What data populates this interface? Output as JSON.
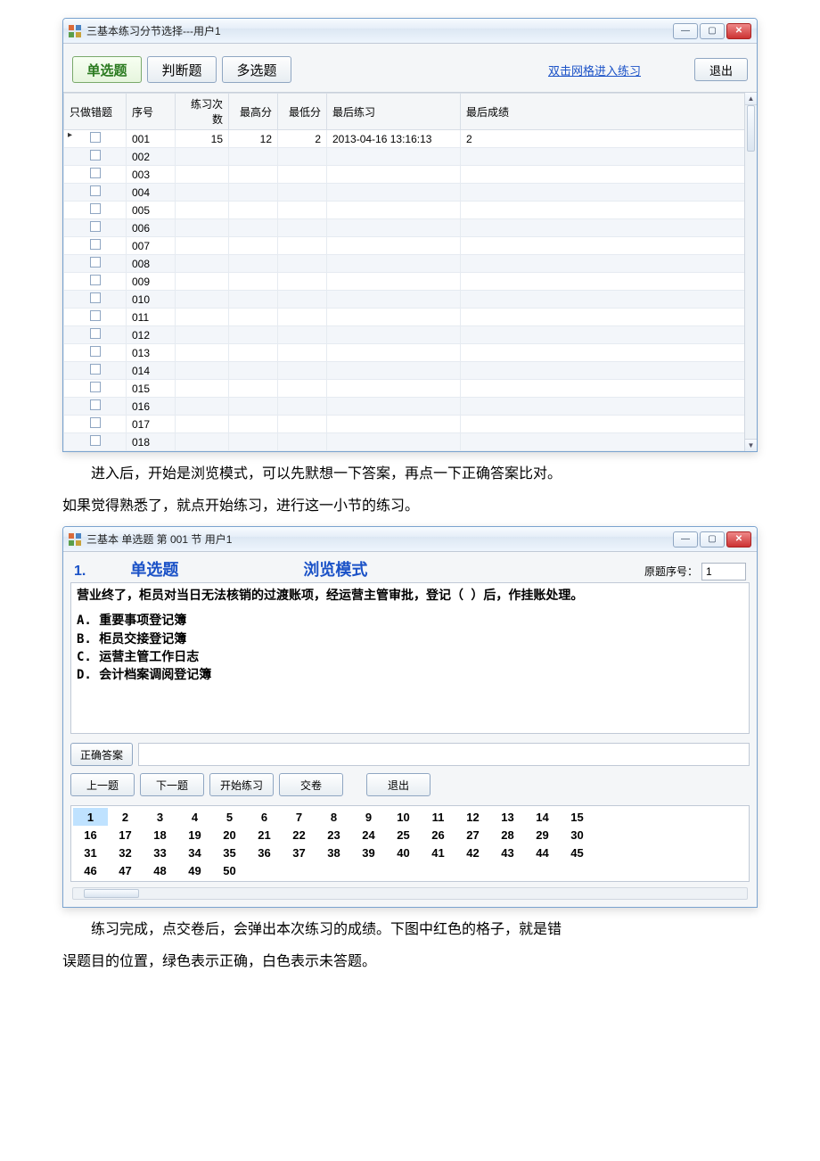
{
  "win1": {
    "title": "三基本练习分节选择---用户1",
    "tabs": {
      "single": "单选题",
      "judge": "判断题",
      "multi": "多选题"
    },
    "hint": "双击网格进入练习",
    "exit": "退出",
    "columns": {
      "only_wrong": "只做错题",
      "seq": "序号",
      "times": "练习次数",
      "high": "最高分",
      "low": "最低分",
      "last_time": "最后练习",
      "last_score": "最后成绩"
    },
    "rows": [
      {
        "seq": "001",
        "times": "15",
        "high": "12",
        "low": "2",
        "last_time": "2013-04-16 13:16:13",
        "last_score": "2"
      },
      {
        "seq": "002"
      },
      {
        "seq": "003"
      },
      {
        "seq": "004"
      },
      {
        "seq": "005"
      },
      {
        "seq": "006"
      },
      {
        "seq": "007"
      },
      {
        "seq": "008"
      },
      {
        "seq": "009"
      },
      {
        "seq": "010"
      },
      {
        "seq": "011"
      },
      {
        "seq": "012"
      },
      {
        "seq": "013"
      },
      {
        "seq": "014"
      },
      {
        "seq": "015"
      },
      {
        "seq": "016"
      },
      {
        "seq": "017"
      },
      {
        "seq": "018"
      }
    ]
  },
  "para1a": "进入后，开始是浏览模式，可以先默想一下答案，再点一下正确答案比对。",
  "para1b": "如果觉得熟悉了，就点开始练习，进行这一小节的练习。",
  "win2": {
    "title": "三基本 单选题 第 001 节 用户1",
    "qnum": "1.",
    "qtype": "单选题",
    "mode": "浏览模式",
    "orig_label": "原题序号：",
    "orig_value": "1",
    "question": "营业终了，柜员对当日无法核销的过渡账项，经运营主管审批，登记（ ）后，作挂账处理。",
    "options": [
      "A. 重要事项登记簿",
      "B. 柜员交接登记簿",
      "C. 运营主管工作日志",
      "D. 会计档案调阅登记簿"
    ],
    "btn_answer": "正确答案",
    "btns": {
      "prev": "上一题",
      "next": "下一题",
      "start": "开始练习",
      "submit": "交卷",
      "exit": "退出"
    },
    "numbers_max": 50,
    "numbers_selected": 1
  },
  "para2a": "练习完成，点交卷后，会弹出本次练习的成绩。下图中红色的格子，就是错",
  "para2b": "误题目的位置，绿色表示正确，白色表示未答题。"
}
